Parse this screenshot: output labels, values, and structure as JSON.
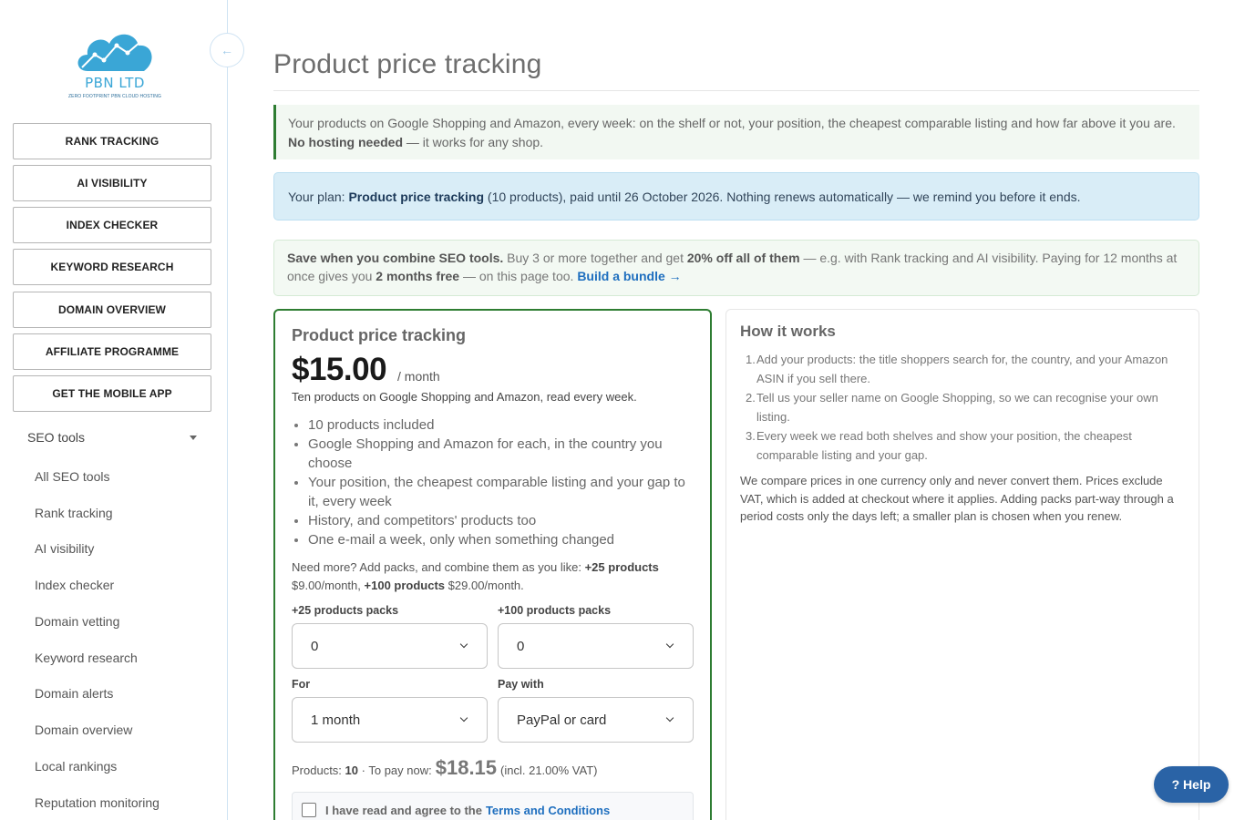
{
  "logo": {
    "name": "PBN LTD",
    "tagline": "ZERO FOOTPRINT PBN CLOUD HOSTING"
  },
  "sidebar": {
    "collapse_icon": "arrow-left-icon",
    "buttons": [
      "RANK TRACKING",
      "AI VISIBILITY",
      "INDEX CHECKER",
      "KEYWORD RESEARCH",
      "DOMAIN OVERVIEW",
      "AFFILIATE PROGRAMME",
      "GET THE MOBILE APP"
    ],
    "group_label": "SEO tools",
    "sub_items": [
      "All SEO tools",
      "Rank tracking",
      "AI visibility",
      "Index checker",
      "Domain vetting",
      "Keyword research",
      "Domain alerts",
      "Domain overview",
      "Local rankings",
      "Reputation monitoring"
    ]
  },
  "page": {
    "title": "Product price tracking",
    "intro_text": "Your products on Google Shopping and Amazon, every week: on the shelf or not, your position, the cheapest comparable listing and how far above it you are.",
    "intro_bold": "No hosting needed",
    "intro_tail": "— it works for any shop.",
    "plan_prefix": "Your plan:",
    "plan_name": "Product price tracking",
    "plan_text": "(10 products), paid until 26 October 2026. Nothing renews automatically — we remind you before it ends.",
    "promo_bold1": "Save when you combine SEO tools.",
    "promo_text1": "Buy 3 or more together and get",
    "promo_bold2": "20% off all of them",
    "promo_text2": "— e.g. with Rank tracking and AI visibility. Paying for 12 months at once gives you",
    "promo_bold3": "2 months free",
    "promo_text3": "— on this page too.",
    "promo_link": "Build a bundle →"
  },
  "card": {
    "title": "Product price tracking",
    "price": "$15.00",
    "per": "/ month",
    "subtitle": "Ten products on Google Shopping and Amazon, read every week.",
    "features": [
      "10 products included",
      "Google Shopping and Amazon for each, in the country you choose",
      "Your position, the cheapest comparable listing and your gap to it, every week",
      "History, and competitors' products too",
      "One e-mail a week, only when something changed"
    ],
    "need_more_text": "Need more? Add packs, and combine them as you like:",
    "pack25_bold": "+25 products",
    "pack25_price": "$9.00/month,",
    "pack100_bold": "+100 products",
    "pack100_price": "$29.00/month.",
    "pack25_label": "+25 products packs",
    "pack25_value": "0",
    "pack100_label": "+100 products packs",
    "pack100_value": "0",
    "for_label": "For",
    "for_value": "1 month",
    "pay_label": "Pay with",
    "pay_value": "PayPal or card",
    "summary_products_label": "Products:",
    "summary_products": "10",
    "summary_pay_label": "· To pay now:",
    "summary_total": "$18.15",
    "summary_vat": "(incl. 21.00% VAT)",
    "agree_text": "I have read and agree to the",
    "agree_link": "Terms and Conditions"
  },
  "how": {
    "title": "How it works",
    "steps": [
      "Add your products: the title shoppers search for, the country, and your Amazon ASIN if you sell there.",
      "Tell us your seller name on Google Shopping, so we can recognise your own listing.",
      "Every week we read both shelves and show your position, the cheapest comparable listing and your gap."
    ],
    "note": "We compare prices in one currency only and never convert them. Prices exclude VAT, which is added at checkout where it applies. Adding packs part-way through a period costs only the days left; a smaller plan is chosen when you renew."
  },
  "help_button": "? Help"
}
